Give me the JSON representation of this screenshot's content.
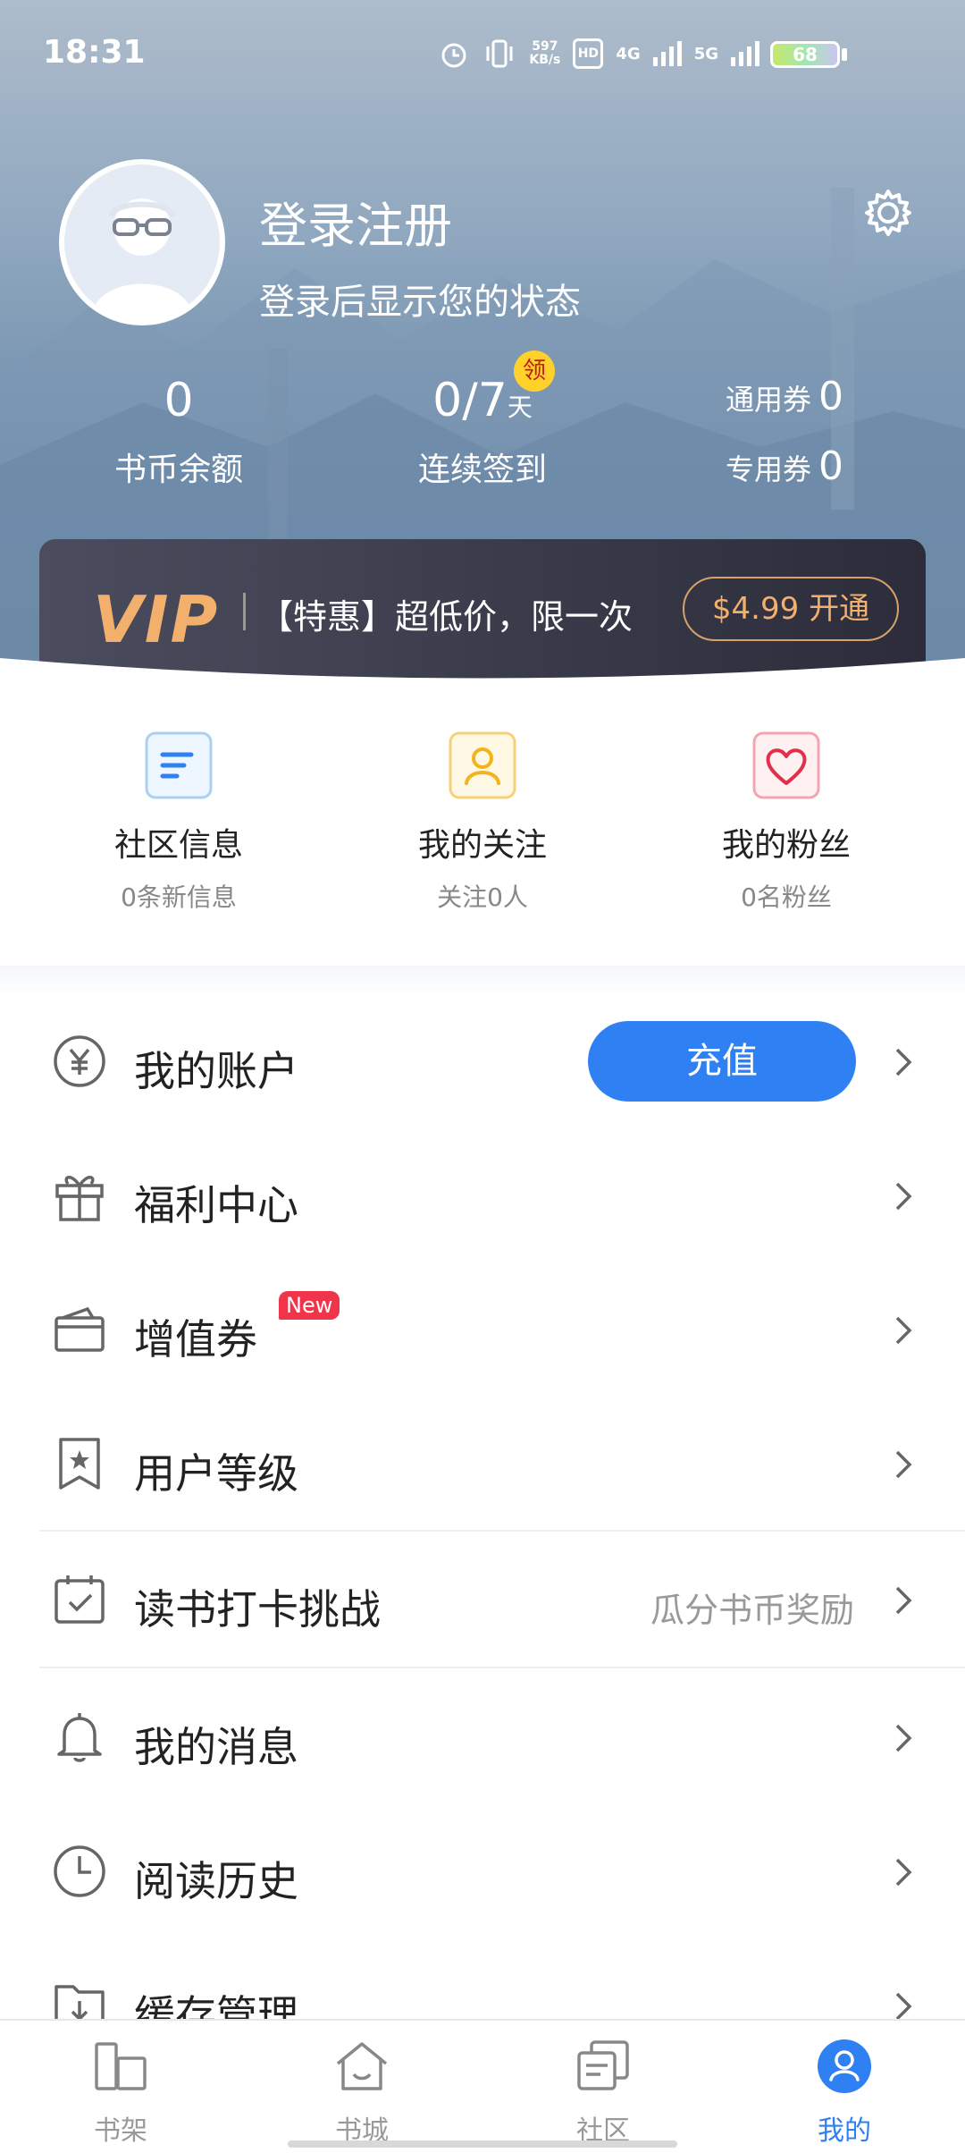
{
  "status_bar": {
    "time": "18:31",
    "net_speed_value": "597",
    "net_speed_unit": "KB/s",
    "hd": "HD",
    "net1": "4G",
    "net2": "5G",
    "battery": "68"
  },
  "profile": {
    "title": "登录注册",
    "subtitle": "登录后显示您的状态"
  },
  "stats": {
    "coins_value": "0",
    "coins_label": "书币余额",
    "checkin_value": "0/7",
    "checkin_unit": "天",
    "checkin_label": "连续签到",
    "claim_badge": "领",
    "general_coupon_label": "通用券",
    "general_coupon_value": "0",
    "special_coupon_label": "专用券",
    "special_coupon_value": "0"
  },
  "vip": {
    "logo": "VIP",
    "promo_text": "【特惠】超低价，限一次",
    "button_label": "$4.99 开通"
  },
  "quick": [
    {
      "label": "社区信息",
      "sub": "0条新信息"
    },
    {
      "label": "我的关注",
      "sub": "关注0人"
    },
    {
      "label": "我的粉丝",
      "sub": "0名粉丝"
    }
  ],
  "menu": {
    "account": "我的账户",
    "recharge": "充值",
    "welfare": "福利中心",
    "voucher": "增值券",
    "new_badge": "New",
    "level": "用户等级",
    "challenge": "读书打卡挑战",
    "challenge_hint": "瓜分书币奖励",
    "messages": "我的消息",
    "history": "阅读历史",
    "cache": "缓存管理"
  },
  "tabs": [
    {
      "label": "书架"
    },
    {
      "label": "书城"
    },
    {
      "label": "社区"
    },
    {
      "label": "我的"
    }
  ],
  "colors": {
    "accent": "#2f80f2",
    "vip_gold": "#f2b06c",
    "badge_red": "#f0344a"
  }
}
